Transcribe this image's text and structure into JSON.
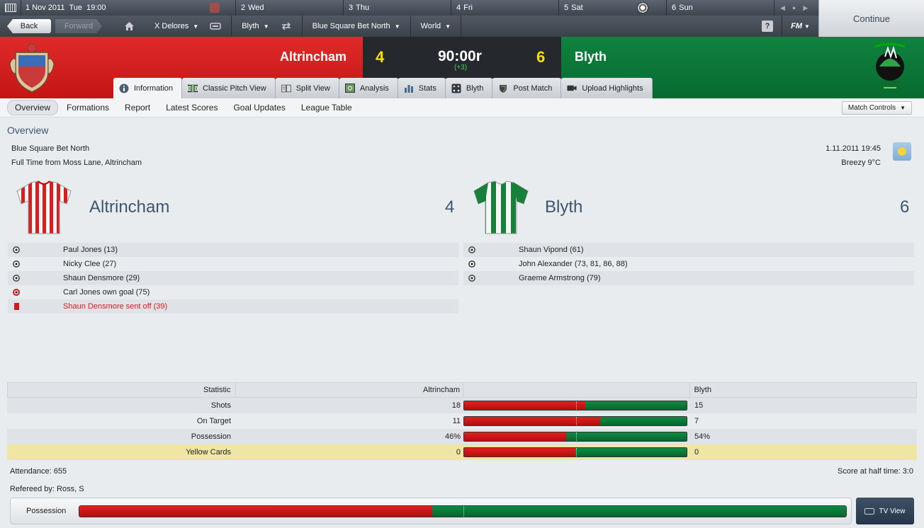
{
  "calendar": {
    "today": "1 Nov 2011",
    "today_day": "Tue",
    "time": "19:00",
    "days": [
      {
        "num": "2",
        "name": "Wed"
      },
      {
        "num": "3",
        "name": "Thu"
      },
      {
        "num": "4",
        "name": "Fri"
      },
      {
        "num": "5",
        "name": "Sat"
      },
      {
        "num": "6",
        "name": "Sun"
      }
    ]
  },
  "nav": {
    "back": "Back",
    "forward": "Forward",
    "manager": "X Delores",
    "club": "Blyth",
    "competition": "Blue Square Bet North",
    "world": "World",
    "help": "?",
    "fm": "FM"
  },
  "continue": "Continue",
  "match": {
    "home_team": "Altrincham",
    "away_team": "Blyth",
    "home_score": "4",
    "away_score": "6",
    "clock": "90:00r",
    "added_time": "(+3)"
  },
  "tabs": [
    "Information",
    "Classic Pitch View",
    "Split View",
    "Analysis",
    "Stats",
    "Blyth",
    "Post Match",
    "Upload Highlights"
  ],
  "subtabs": [
    "Overview",
    "Formations",
    "Report",
    "Latest Scores",
    "Goal Updates",
    "League Table"
  ],
  "match_controls": "Match Controls",
  "overview": {
    "title": "Overview",
    "competition": "Blue Square Bet North",
    "venue": "Full Time from Moss Lane, Altrincham",
    "datetime": "1.11.2011 19:45",
    "weather": "Breezy 9°C"
  },
  "home_events": [
    {
      "type": "goal",
      "text": "Paul Jones (13)"
    },
    {
      "type": "goal",
      "text": "Nicky Clee (27)"
    },
    {
      "type": "goal",
      "text": "Shaun Densmore (29)"
    },
    {
      "type": "own-goal",
      "text": "Carl Jones own goal (75)"
    },
    {
      "type": "red-card",
      "text": "Shaun Densmore sent off (39)"
    }
  ],
  "away_events": [
    {
      "type": "goal",
      "text": "Shaun Vipond (61)"
    },
    {
      "type": "goal",
      "text": "John Alexander (73, 81, 86, 88)"
    },
    {
      "type": "goal",
      "text": "Graeme Armstrong (79)"
    }
  ],
  "stats": {
    "header": {
      "statistic": "Statistic",
      "home": "Altrincham",
      "away": "Blyth"
    },
    "rows": [
      {
        "label": "Shots",
        "home": "18",
        "away": "15",
        "home_share": 0.545
      },
      {
        "label": "On Target",
        "home": "11",
        "away": "7",
        "home_share": 0.611
      },
      {
        "label": "Possession",
        "home": "46%",
        "away": "54%",
        "home_share": 0.46
      },
      {
        "label": "Yellow Cards",
        "home": "0",
        "away": "0",
        "home_share": 0.5
      }
    ]
  },
  "attendance": "Attendance: 655",
  "halftime": "Score at half time: 3:0",
  "referee": "Refereed by: Ross, S",
  "possession_bar": {
    "label": "Possession",
    "home_share": 0.46
  },
  "tv_view": "TV View",
  "colors": {
    "home": "#c41515",
    "away": "#076b30",
    "score": "#f5e000"
  }
}
